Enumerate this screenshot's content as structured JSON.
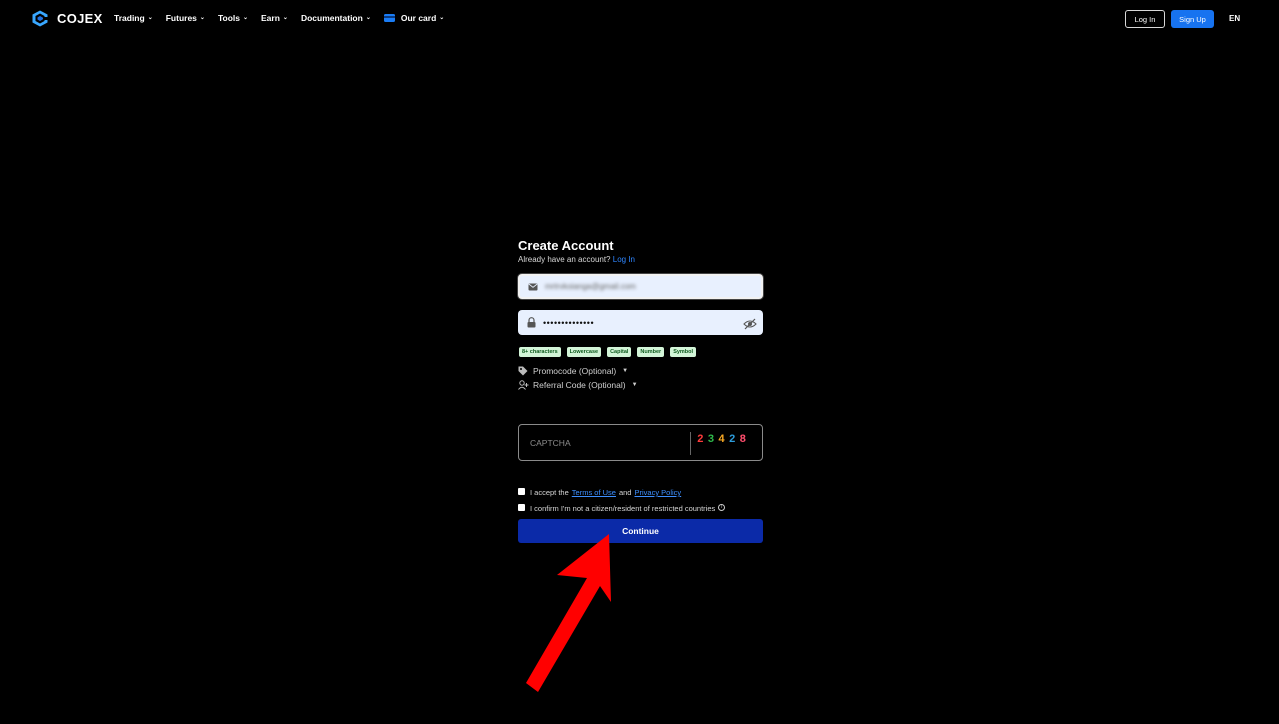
{
  "nav": {
    "brand": "COJEX",
    "menu": [
      {
        "label": "Trading"
      },
      {
        "label": "Futures"
      },
      {
        "label": "Tools"
      },
      {
        "label": "Earn"
      },
      {
        "label": "Documentation"
      },
      {
        "label": "Our card"
      }
    ],
    "login_label": "Log In",
    "signup_label": "Sign Up",
    "language": "EN"
  },
  "form": {
    "title": "Create Account",
    "subtitle": "Already have an account?",
    "login_link": "Log In",
    "email_value": "mrtrvkoianga@gmail.com",
    "password_value": "••••••••••••••",
    "password_rules": [
      "8+ characters",
      "Lowercase",
      "Capital",
      "Number",
      "Symbol"
    ],
    "promocode_label": "Promocode (Optional)",
    "referral_label": "Referral Code (Optional)",
    "captcha_placeholder": "CAPTCHA",
    "captcha_digits": [
      {
        "digit": "2",
        "color": "#ff3b3b"
      },
      {
        "digit": "3",
        "color": "#2eb84b"
      },
      {
        "digit": "4",
        "color": "#f5a623"
      },
      {
        "digit": "2",
        "color": "#2d9cdb"
      },
      {
        "digit": "8",
        "color": "#ff4d6d"
      }
    ],
    "terms_prefix": "I accept the",
    "terms_link": "Terms of Use",
    "terms_and": "and",
    "privacy_link": "Privacy Policy",
    "confirm_text": "I confirm I'm not a citizen/resident of restricted countries",
    "continue_label": "Continue"
  },
  "colors": {
    "background": "#000000",
    "accent": "#1773f0",
    "continue_button": "#0b2aa8",
    "annotation_arrow": "#ff0000"
  }
}
